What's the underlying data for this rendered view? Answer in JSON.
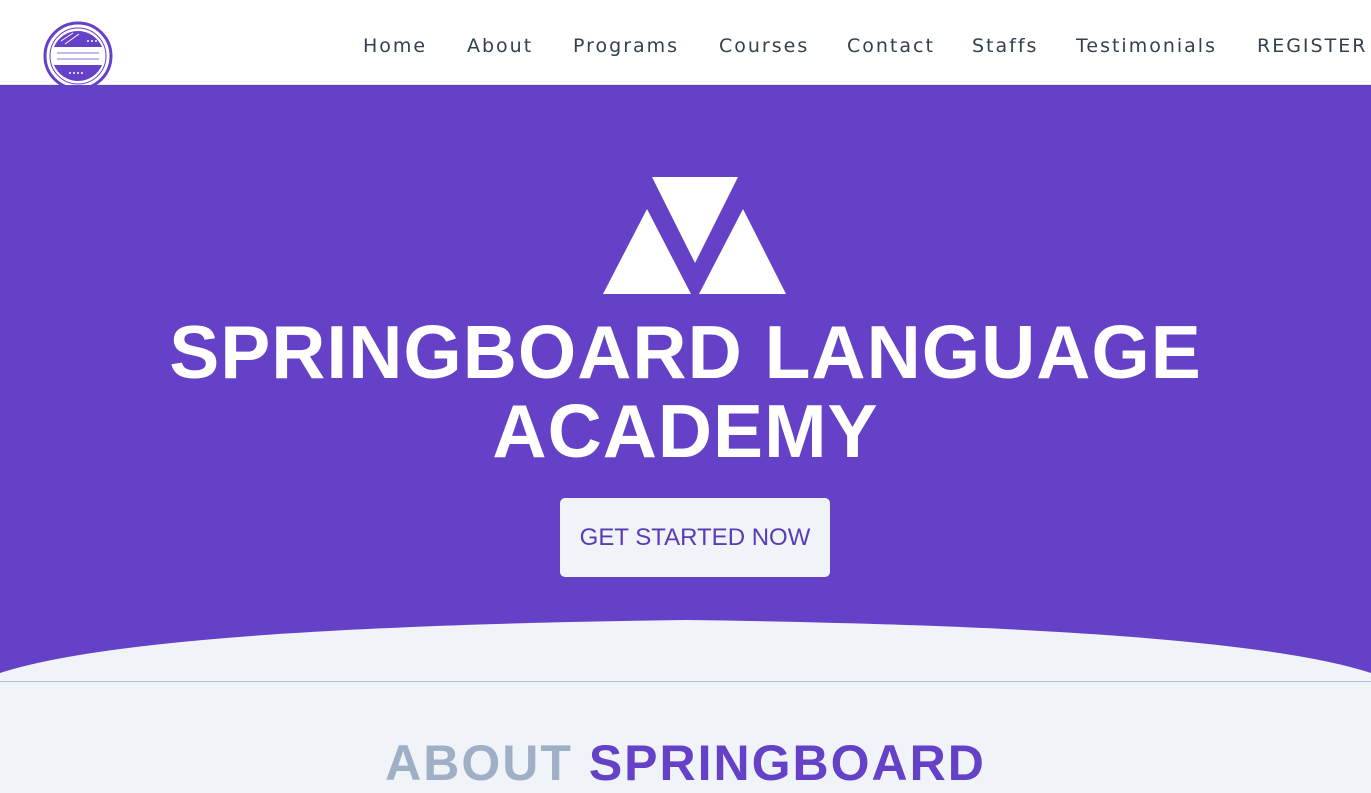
{
  "header": {
    "logo": {
      "icon": "academy-seal-logo",
      "top_text": "Spring Board Language Academy",
      "bottom_text": "Unlock Your Potential"
    },
    "nav": [
      {
        "label": "Home"
      },
      {
        "label": "About"
      },
      {
        "label": "Programs"
      },
      {
        "label": "Courses"
      },
      {
        "label": "Contact"
      },
      {
        "label": "Staffs"
      },
      {
        "label": "Testimonials"
      },
      {
        "label": "REGISTER"
      }
    ]
  },
  "hero": {
    "icon": "springboard-triangles-icon",
    "title": "SPRINGBOARD LANGUAGE ACADEMY",
    "cta_label": "GET STARTED NOW"
  },
  "about": {
    "heading_muted": "ABOUT",
    "heading_accent": "SPRINGBOARD"
  },
  "colors": {
    "brand_purple": "#6441c6",
    "nav_text": "#33404f",
    "light_bg": "#f0f3f7",
    "muted_heading": "#9fb0c6"
  }
}
